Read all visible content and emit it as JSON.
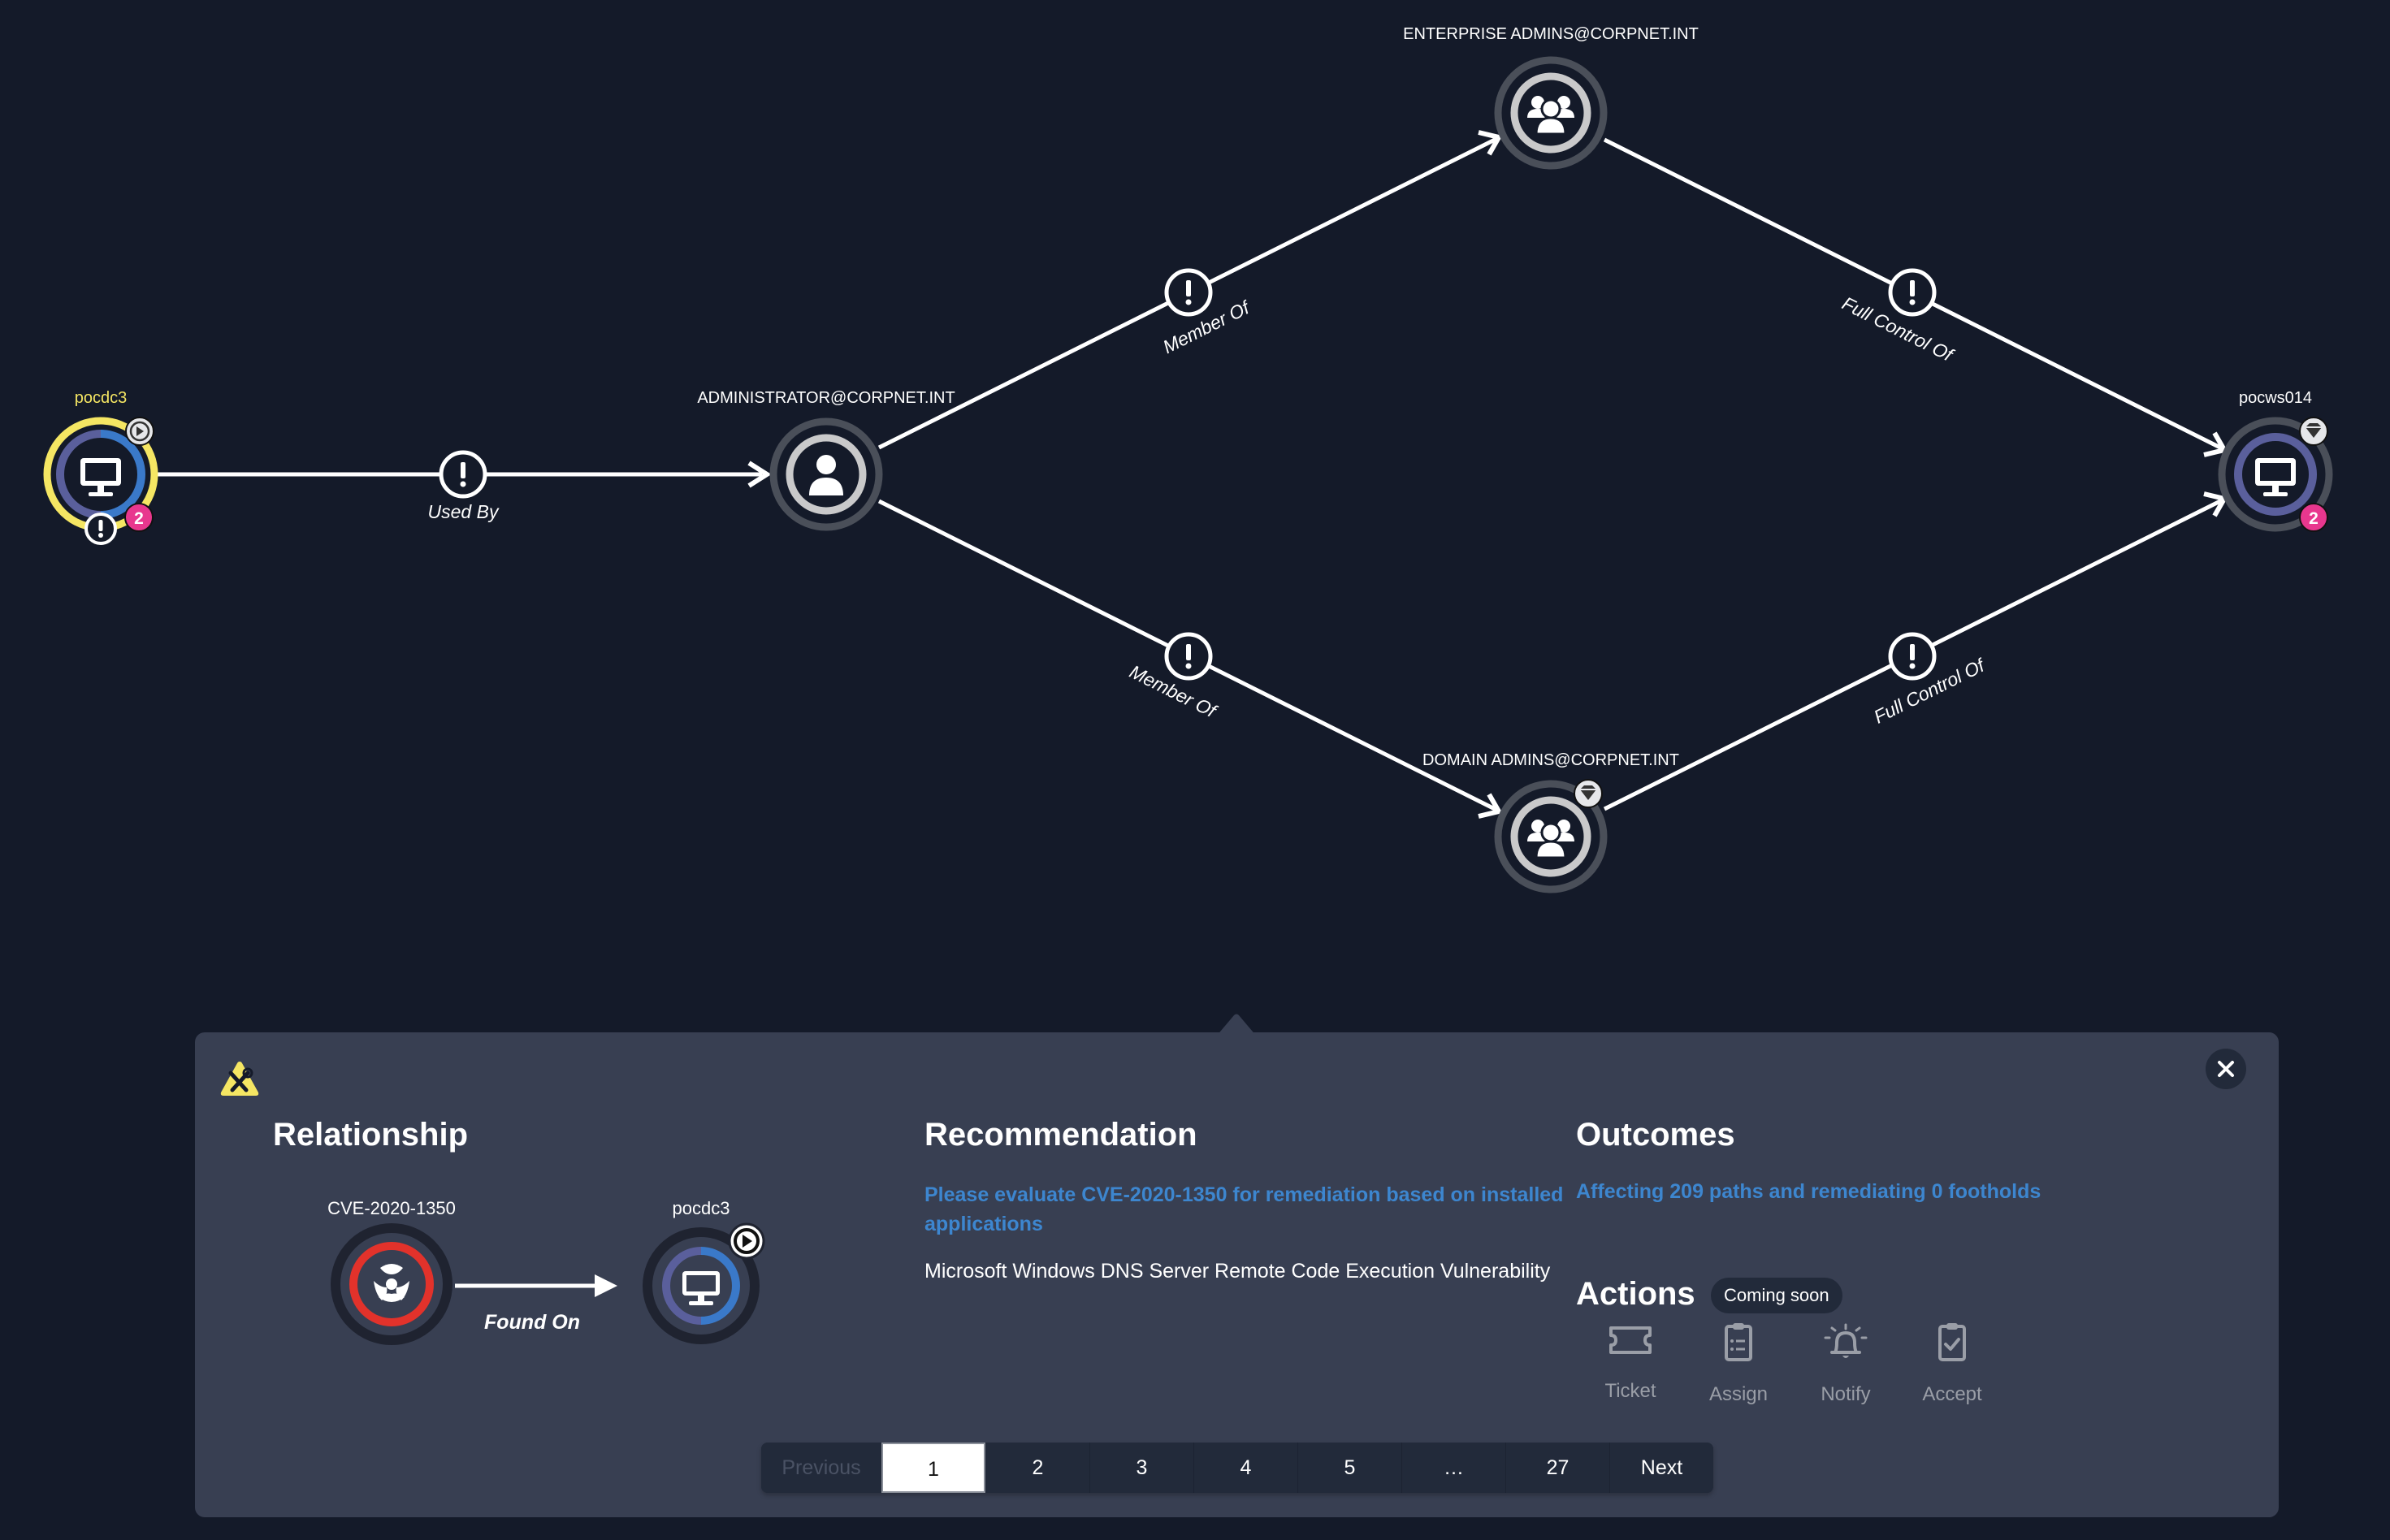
{
  "graph": {
    "nodes": [
      {
        "id": "pocdc3",
        "label": "pocdc3",
        "type": "computer",
        "highlighted": true,
        "badge_count": "2",
        "top_badge": "play-icon",
        "bottom_badge": "alert-icon"
      },
      {
        "id": "administrator",
        "label": "ADMINISTRATOR@CORPNET.INT",
        "type": "user"
      },
      {
        "id": "enterprise_admins",
        "label": "ENTERPRISE ADMINS@CORPNET.INT",
        "type": "group"
      },
      {
        "id": "domain_admins",
        "label": "DOMAIN ADMINS@CORPNET.INT",
        "type": "group",
        "top_badge": "crown-jewel-icon"
      },
      {
        "id": "pocws014",
        "label": "pocws014",
        "type": "computer",
        "badge_count": "2",
        "top_badge": "crown-jewel-icon"
      }
    ],
    "edges": [
      {
        "from": "pocdc3",
        "to": "administrator",
        "label": "Used By"
      },
      {
        "from": "administrator",
        "to": "enterprise_admins",
        "label": "Member Of"
      },
      {
        "from": "administrator",
        "to": "domain_admins",
        "label": "Member Of"
      },
      {
        "from": "enterprise_admins",
        "to": "pocws014",
        "label": "Full Control Of"
      },
      {
        "from": "domain_admins",
        "to": "pocws014",
        "label": "Full Control Of"
      }
    ]
  },
  "panel": {
    "close_label": "Close",
    "relationship": {
      "title": "Relationship",
      "source_label": "CVE-2020-1350",
      "target_label": "pocdc3",
      "edge_label": "Found On"
    },
    "recommendation": {
      "title": "Recommendation",
      "link_text": "Please evaluate CVE-2020-1350 for remediation based on installed applications",
      "description": "Microsoft Windows DNS Server Remote Code Execution Vulnerability"
    },
    "outcomes": {
      "title": "Outcomes",
      "summary": "Affecting 209 paths and remediating 0 footholds"
    },
    "actions": {
      "title": "Actions",
      "badge": "Coming soon",
      "items": [
        {
          "label": "Ticket",
          "icon": "ticket-icon"
        },
        {
          "label": "Assign",
          "icon": "clipboard-list-icon"
        },
        {
          "label": "Notify",
          "icon": "bell-icon"
        },
        {
          "label": "Accept",
          "icon": "clipboard-check-icon"
        }
      ]
    },
    "pagination": {
      "previous": "Previous",
      "pages": [
        "1",
        "2",
        "3",
        "4",
        "5",
        "…",
        "27"
      ],
      "current": "1",
      "next": "Next"
    }
  },
  "colors": {
    "background": "#141a29",
    "panel": "#383f52",
    "highlight": "#f5e663",
    "link": "#3d86cf",
    "badge": "#e8378e",
    "vuln": "#e2322b"
  }
}
